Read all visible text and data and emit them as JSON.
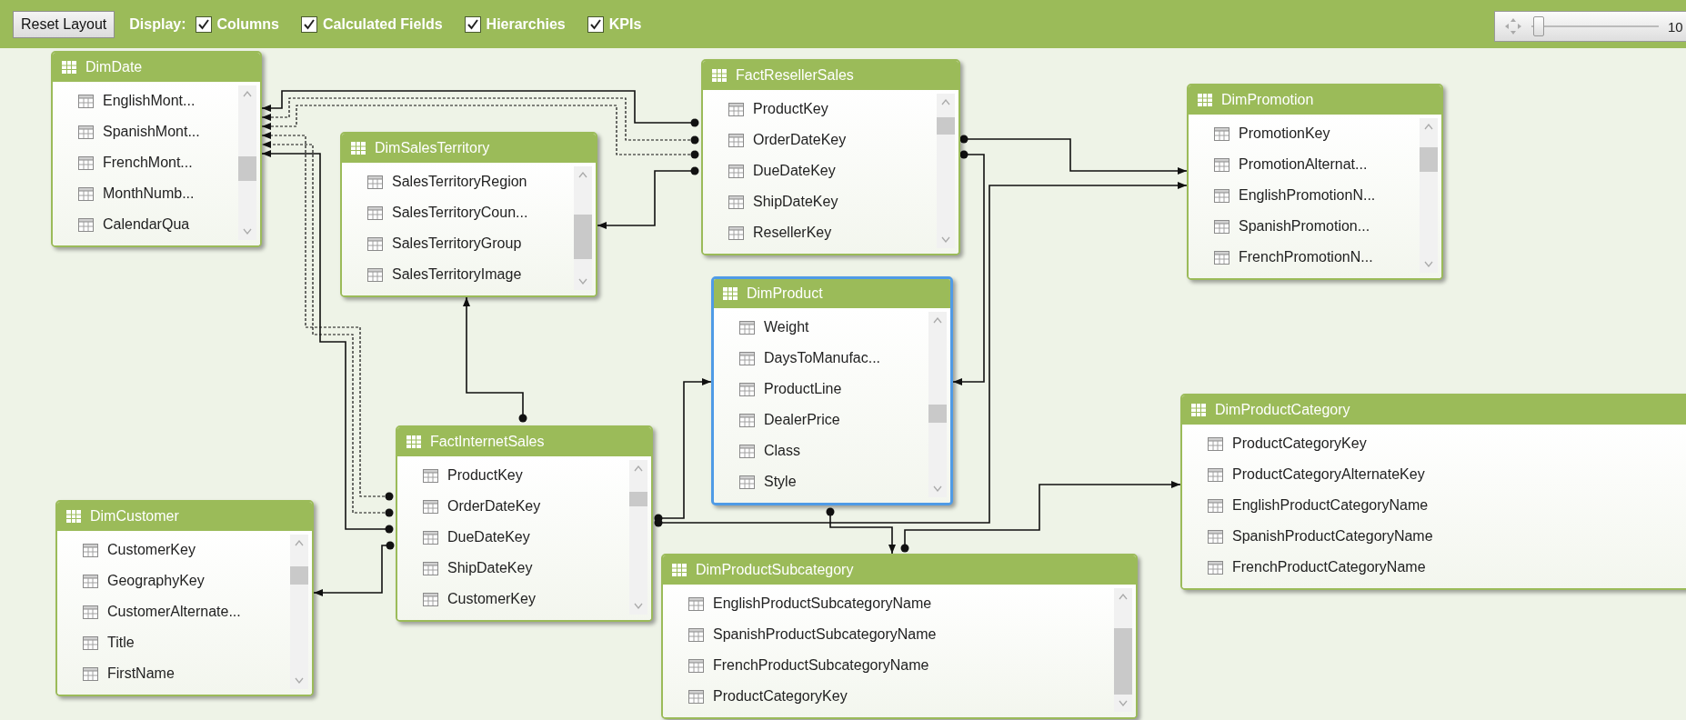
{
  "toolbar": {
    "reset_button": "Reset Layout",
    "display_label": "Display:",
    "checkboxes": [
      {
        "label": "Columns",
        "checked": true
      },
      {
        "label": "Calculated Fields",
        "checked": true
      },
      {
        "label": "Hierarchies",
        "checked": true
      },
      {
        "label": "KPIs",
        "checked": true
      }
    ],
    "zoom": {
      "level": 0.06,
      "reading": "10"
    }
  },
  "tables": [
    {
      "name": "DimDate",
      "selected": false,
      "columns": [
        "EnglishMont...",
        "SpanishMont...",
        "FrenchMont...",
        "MonthNumb...",
        "CalendarQua"
      ]
    },
    {
      "name": "FactResellerSales",
      "selected": false,
      "columns": [
        "ProductKey",
        "OrderDateKey",
        "DueDateKey",
        "ShipDateKey",
        "ResellerKey"
      ]
    },
    {
      "name": "DimPromotion",
      "selected": false,
      "columns": [
        "PromotionKey",
        "PromotionAlternat...",
        "EnglishPromotionN...",
        "SpanishPromotion...",
        "FrenchPromotionN..."
      ]
    },
    {
      "name": "DimSalesTerritory",
      "selected": false,
      "columns": [
        "SalesTerritoryRegion",
        "SalesTerritoryCoun...",
        "SalesTerritoryGroup",
        "SalesTerritoryImage"
      ]
    },
    {
      "name": "DimProduct",
      "selected": true,
      "columns": [
        "Weight",
        "DaysToManufac...",
        "ProductLine",
        "DealerPrice",
        "Class",
        "Style"
      ]
    },
    {
      "name": "DimProductCategory",
      "selected": false,
      "columns": [
        "ProductCategoryKey",
        "ProductCategoryAlternateKey",
        "EnglishProductCategoryName",
        "SpanishProductCategoryName",
        "FrenchProductCategoryName"
      ]
    },
    {
      "name": "FactInternetSales",
      "selected": false,
      "columns": [
        "ProductKey",
        "OrderDateKey",
        "DueDateKey",
        "ShipDateKey",
        "CustomerKey"
      ]
    },
    {
      "name": "DimCustomer",
      "selected": false,
      "columns": [
        "CustomerKey",
        "GeographyKey",
        "CustomerAlternate...",
        "Title",
        "FirstName"
      ]
    },
    {
      "name": "DimProductSubcategory",
      "selected": false,
      "columns": [
        "EnglishProductSubcategoryName",
        "SpanishProductSubcategoryName",
        "FrenchProductSubcategoryName",
        "ProductCategoryKey"
      ]
    }
  ],
  "relationships": [
    {
      "active": true
    },
    {
      "active": false
    },
    {
      "active": false
    },
    {
      "active": true
    },
    {
      "active": false
    },
    {
      "active": false
    },
    {
      "active": true
    },
    {
      "active": true
    },
    {
      "active": true
    },
    {
      "active": true
    },
    {
      "active": true
    },
    {
      "active": true
    },
    {
      "active": true
    },
    {
      "active": true
    },
    {
      "active": true
    }
  ]
}
